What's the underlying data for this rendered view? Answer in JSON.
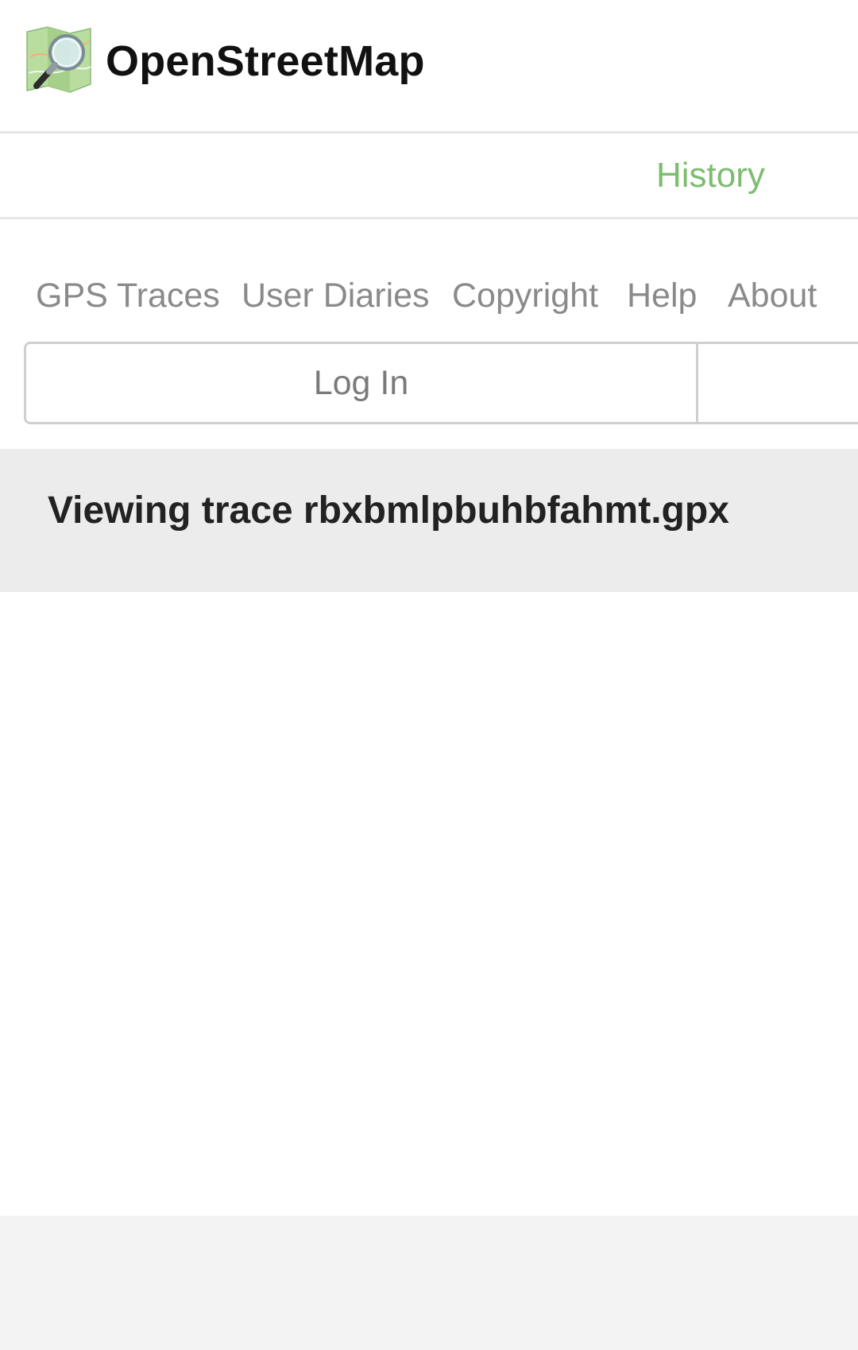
{
  "header": {
    "brand": "OpenStreetMap",
    "logo_icon": "osm-logo-icon"
  },
  "tabs": {
    "history_label": "History"
  },
  "secondary_nav": {
    "items": [
      {
        "label": "GPS Traces"
      },
      {
        "label": "User Diaries"
      },
      {
        "label": "Copyright"
      },
      {
        "label": "Help"
      },
      {
        "label": "About"
      }
    ]
  },
  "auth": {
    "login_label": "Log In"
  },
  "content": {
    "heading": "Viewing trace rbxbmlpbuhbfahmt.gpx"
  },
  "colors": {
    "accent": "#7ebc6f",
    "nav_text": "#8a8a8a",
    "heading_bg": "#ececec"
  }
}
